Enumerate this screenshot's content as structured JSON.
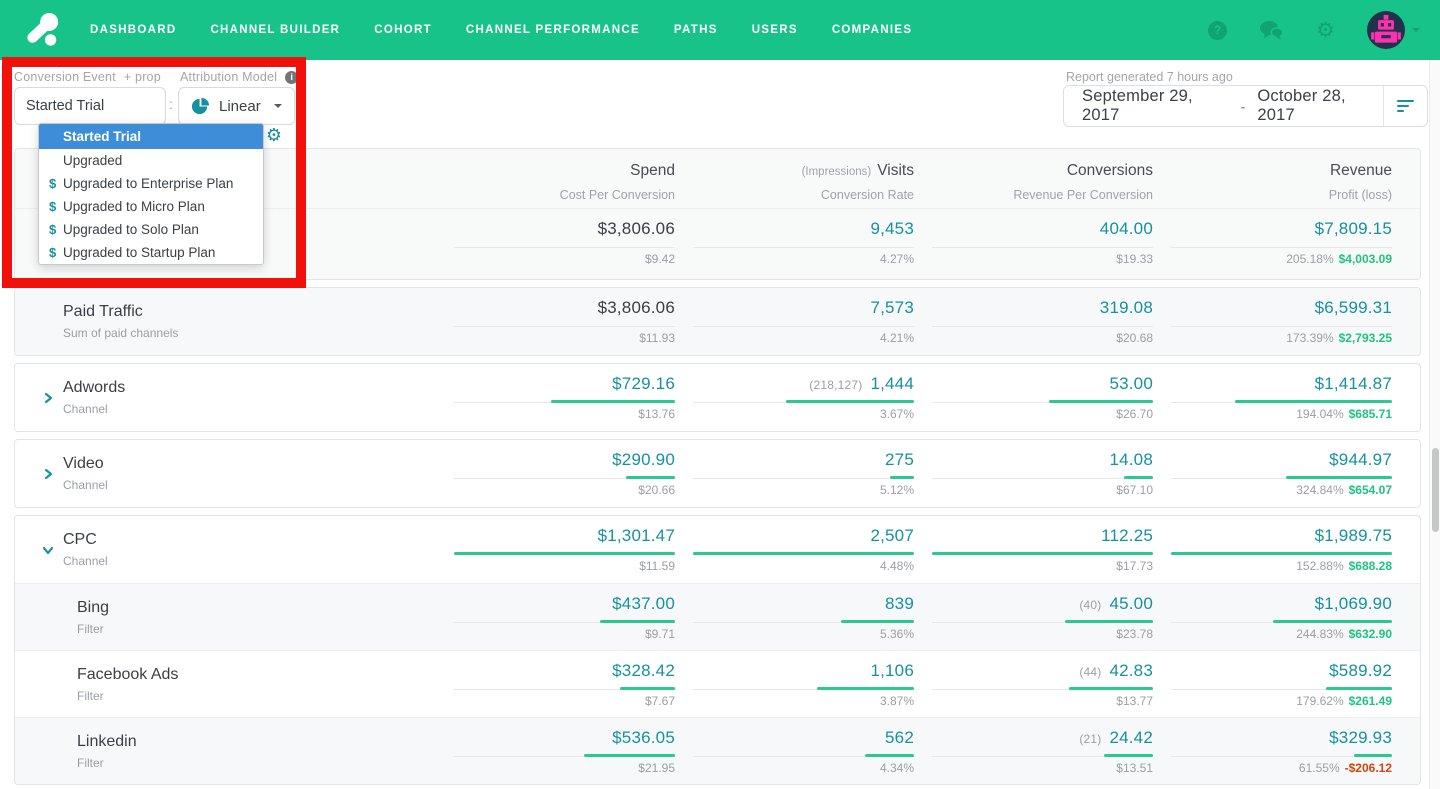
{
  "colors": {
    "nav_green": "#18c38a",
    "icon_dark": "#10a473",
    "teal": "#16919e",
    "bar_green": "#2bc98f",
    "profit_green": "#1fc380",
    "loss_red": "#d2430f",
    "highlight_blue": "#3e8dd8",
    "annotation_red": "#f2100a"
  },
  "nav": {
    "items": [
      "DASHBOARD",
      "CHANNEL BUILDER",
      "COHORT",
      "CHANNEL PERFORMANCE",
      "PATHS",
      "USERS",
      "COMPANIES"
    ],
    "help_glyph": "?",
    "gear_glyph": "⚙"
  },
  "controls": {
    "conversion_event_label": "Conversion Event",
    "conversion_event_addon": "+ prop",
    "conversion_event_value": "Started Trial",
    "separator": ":",
    "attribution_model_label": "Attribution Model",
    "attribution_model_info": "i",
    "attribution_model_value": "Linear",
    "dropdown": {
      "items": [
        {
          "label": "Started Trial",
          "dollar": false,
          "selected": true
        },
        {
          "label": "Upgraded",
          "dollar": false,
          "selected": false
        },
        {
          "label": "Upgraded to Enterprise Plan",
          "dollar": true,
          "selected": false
        },
        {
          "label": "Upgraded to Micro Plan",
          "dollar": true,
          "selected": false
        },
        {
          "label": "Upgraded to Solo Plan",
          "dollar": true,
          "selected": false
        },
        {
          "label": "Upgraded to Startup Plan",
          "dollar": true,
          "selected": false
        }
      ]
    }
  },
  "report": {
    "generated_label": "Report generated 7 hours ago",
    "date_start": "September 29, 2017",
    "date_separator": "-",
    "date_end": "October 28, 2017"
  },
  "table": {
    "header": {
      "cols": [
        {
          "pre": "",
          "title": "Spend",
          "subtitle": "Cost Per Conversion"
        },
        {
          "pre": "(Impressions)",
          "title": "Visits",
          "subtitle": "Conversion Rate"
        },
        {
          "pre": "",
          "title": "Conversions",
          "subtitle": "Revenue Per Conversion"
        },
        {
          "pre": "",
          "title": "Revenue",
          "subtitle": "Profit (loss)"
        }
      ]
    },
    "cards": [
      {
        "with_header": true,
        "shaded_card": true,
        "rows": [
          {
            "title": "",
            "subtitle": "",
            "type": "summary",
            "tall": true,
            "shaded": false,
            "spend_dark": true,
            "chevron": null,
            "cells": [
              {
                "main": "$3,806.06",
                "sub": "$9.42",
                "bar": 0
              },
              {
                "main": "9,453",
                "sub": "4.27%",
                "bar": 0
              },
              {
                "main": "404.00",
                "sub": "$19.33",
                "bar": 0
              },
              {
                "main": "$7,809.15",
                "sub": "205.18%",
                "profit": "$4,003.09",
                "profit_color": "green",
                "bar": 0
              }
            ]
          }
        ]
      },
      {
        "rows": [
          {
            "title": "Paid Traffic",
            "subtitle": "Sum of paid channels",
            "type": "summary",
            "shaded": true,
            "spend_dark": true,
            "chevron": null,
            "cells": [
              {
                "main": "$3,806.06",
                "sub": "$11.93",
                "bar": 0
              },
              {
                "main": "7,573",
                "sub": "4.21%",
                "bar": 0
              },
              {
                "main": "319.08",
                "sub": "$20.68",
                "bar": 0
              },
              {
                "main": "$6,599.31",
                "sub": "173.39%",
                "profit": "$2,793.25",
                "profit_color": "green",
                "bar": 0
              }
            ]
          }
        ]
      },
      {
        "rows": [
          {
            "title": "Adwords",
            "subtitle": "Channel",
            "type": "channel",
            "chevron": "right",
            "cells": [
              {
                "main": "$729.16",
                "sub": "$13.76",
                "bar": 56
              },
              {
                "pre": "(218,127)",
                "main": "1,444",
                "sub": "3.67%",
                "bar": 58
              },
              {
                "main": "53.00",
                "sub": "$26.70",
                "bar": 47
              },
              {
                "main": "$1,414.87",
                "sub": "194.04%",
                "profit": "$685.71",
                "profit_color": "green",
                "bar": 71
              }
            ]
          }
        ]
      },
      {
        "rows": [
          {
            "title": "Video",
            "subtitle": "Channel",
            "type": "channel",
            "chevron": "right",
            "cells": [
              {
                "main": "$290.90",
                "sub": "$20.66",
                "bar": 22
              },
              {
                "main": "275",
                "sub": "5.12%",
                "bar": 11
              },
              {
                "main": "14.08",
                "sub": "$67.10",
                "bar": 13
              },
              {
                "main": "$944.97",
                "sub": "324.84%",
                "profit": "$654.07",
                "profit_color": "green",
                "bar": 48
              }
            ]
          }
        ]
      },
      {
        "rows": [
          {
            "title": "CPC",
            "subtitle": "Channel",
            "type": "channel",
            "chevron": "down",
            "cells": [
              {
                "main": "$1,301.47",
                "sub": "$11.59",
                "bar": 100
              },
              {
                "main": "2,507",
                "sub": "4.48%",
                "bar": 100
              },
              {
                "main": "112.25",
                "sub": "$17.73",
                "bar": 100
              },
              {
                "main": "$1,989.75",
                "sub": "152.88%",
                "profit": "$688.28",
                "profit_color": "green",
                "bar": 100
              }
            ]
          },
          {
            "title": "Bing",
            "subtitle": "Filter",
            "type": "filter",
            "shaded": true,
            "cells": [
              {
                "main": "$437.00",
                "sub": "$9.71",
                "bar": 34
              },
              {
                "main": "839",
                "sub": "5.36%",
                "bar": 33
              },
              {
                "pre": "(40)",
                "main": "45.00",
                "sub": "$23.78",
                "bar": 40
              },
              {
                "main": "$1,069.90",
                "sub": "244.83%",
                "profit": "$632.90",
                "profit_color": "green",
                "bar": 54
              }
            ]
          },
          {
            "title": "Facebook Ads",
            "subtitle": "Filter",
            "type": "filter",
            "shaded": false,
            "cells": [
              {
                "main": "$328.42",
                "sub": "$7.67",
                "bar": 25
              },
              {
                "main": "1,106",
                "sub": "3.87%",
                "bar": 44
              },
              {
                "pre": "(44)",
                "main": "42.83",
                "sub": "$13.77",
                "bar": 38
              },
              {
                "main": "$589.92",
                "sub": "179.62%",
                "profit": "$261.49",
                "profit_color": "green",
                "bar": 30
              }
            ]
          },
          {
            "title": "Linkedin",
            "subtitle": "Filter",
            "type": "filter",
            "shaded": true,
            "cells": [
              {
                "main": "$536.05",
                "sub": "$21.95",
                "bar": 41
              },
              {
                "main": "562",
                "sub": "4.34%",
                "bar": 22
              },
              {
                "pre": "(21)",
                "main": "24.42",
                "sub": "$13.51",
                "bar": 22
              },
              {
                "main": "$329.93",
                "sub": "61.55%",
                "profit": "-$206.12",
                "profit_color": "red",
                "bar": 17
              }
            ]
          }
        ]
      }
    ]
  }
}
